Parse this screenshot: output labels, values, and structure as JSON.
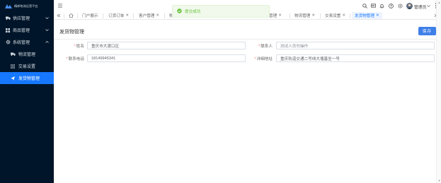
{
  "sidebar": {
    "logo_text": "精郎物流运营平台",
    "items": [
      {
        "label": "供应管理",
        "icon": "truck-icon"
      },
      {
        "label": "商品管理",
        "icon": "grid-icon"
      },
      {
        "label": "系统管理",
        "icon": "gear-icon"
      }
    ],
    "subitems": [
      {
        "label": "物流管理",
        "icon": "truck-icon"
      },
      {
        "label": "交易设置",
        "icon": "sliders-icon"
      },
      {
        "label": "发货物管理",
        "icon": "send-icon"
      }
    ]
  },
  "header": {
    "user_name": "管理员"
  },
  "tabs": [
    {
      "label": "门户展示",
      "closable": false
    },
    {
      "label": "订货订单",
      "closable": true
    },
    {
      "label": "客户管理",
      "closable": true
    },
    {
      "label": "物",
      "closable": false
    },
    {
      "label": "管理",
      "closable": true
    },
    {
      "label": "物流管理",
      "closable": true
    },
    {
      "label": "交易设置",
      "closable": true
    },
    {
      "label": "发货物管理",
      "closable": true
    }
  ],
  "toast": {
    "message": "提交成功"
  },
  "page": {
    "title": "发货物管理",
    "save_label": "保存"
  },
  "form": {
    "name_label": "姓名",
    "name_value": "重庆市大渡口区",
    "contact_label": "联系人",
    "contact_placeholder": "测试人员勿操作",
    "phone_label": "联系电话",
    "phone_value": "18149945341",
    "address_label": "详细地址",
    "address_value": "重庆轨道交通二号线大堰基坐一号"
  },
  "colors": {
    "sidebar_bg": "#001529",
    "accent": "#1677ff",
    "success": "#67c23a"
  }
}
